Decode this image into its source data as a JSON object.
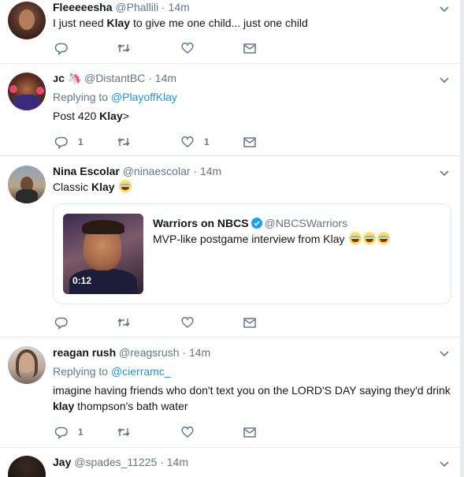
{
  "tweets": [
    {
      "name": "Fleeeeesha",
      "handle": "@Phallili",
      "dot": "·",
      "time": "14m",
      "text_before": "I just need ",
      "keyword": "Klay",
      "text_after": " to give me one child... just one child",
      "actions": {
        "reply_count": "",
        "retweet_count": "",
        "like_count": ""
      }
    },
    {
      "name": "ᴊᴄ 🦄",
      "handle": "@DistantBC",
      "dot": "·",
      "time": "14m",
      "replying_label": "Replying to ",
      "replying_to": "@PlayoffKlay",
      "text_before": "Post 420 ",
      "keyword": "Klay",
      "text_after": ">",
      "actions": {
        "reply_count": "1",
        "retweet_count": "",
        "like_count": "1"
      }
    },
    {
      "name": "Nina Escolar",
      "handle": "@ninaescolar",
      "dot": "·",
      "time": "14m",
      "text_before": "Classic ",
      "keyword": "Klay",
      "text_after": "",
      "emoji": "face-with-tears-of-joy",
      "card": {
        "source_name": "Warriors on NBCS",
        "source_handle": "@NBCSWarriors",
        "text": "MVP-like postgame interview from Klay",
        "emoji_count": 3,
        "video_duration": "0:12"
      },
      "actions": {
        "reply_count": "",
        "retweet_count": "",
        "like_count": ""
      }
    },
    {
      "name": "reagan rush",
      "handle": "@reagsrush",
      "dot": "·",
      "time": "14m",
      "replying_label": "Replying to ",
      "replying_to": "@cierramc_",
      "line1": "imagine having friends who don't text you on the LORD'S DAY saying they'd drink",
      "keyword": "klay",
      "line2_after": " thompson's bath water",
      "actions": {
        "reply_count": "1",
        "retweet_count": "",
        "like_count": ""
      }
    },
    {
      "name": "Jay",
      "handle": "@spades_11225",
      "dot": "·",
      "time": "14m"
    }
  ],
  "colors": {
    "link": "#1b95e0",
    "muted": "#657786",
    "verified": "#1da1f2",
    "divider": "#e6ecf0"
  },
  "icons": [
    "chevron-down-icon",
    "reply-icon",
    "retweet-icon",
    "like-icon",
    "direct-message-icon",
    "verified-icon",
    "face-with-tears-of-joy-emoji"
  ]
}
